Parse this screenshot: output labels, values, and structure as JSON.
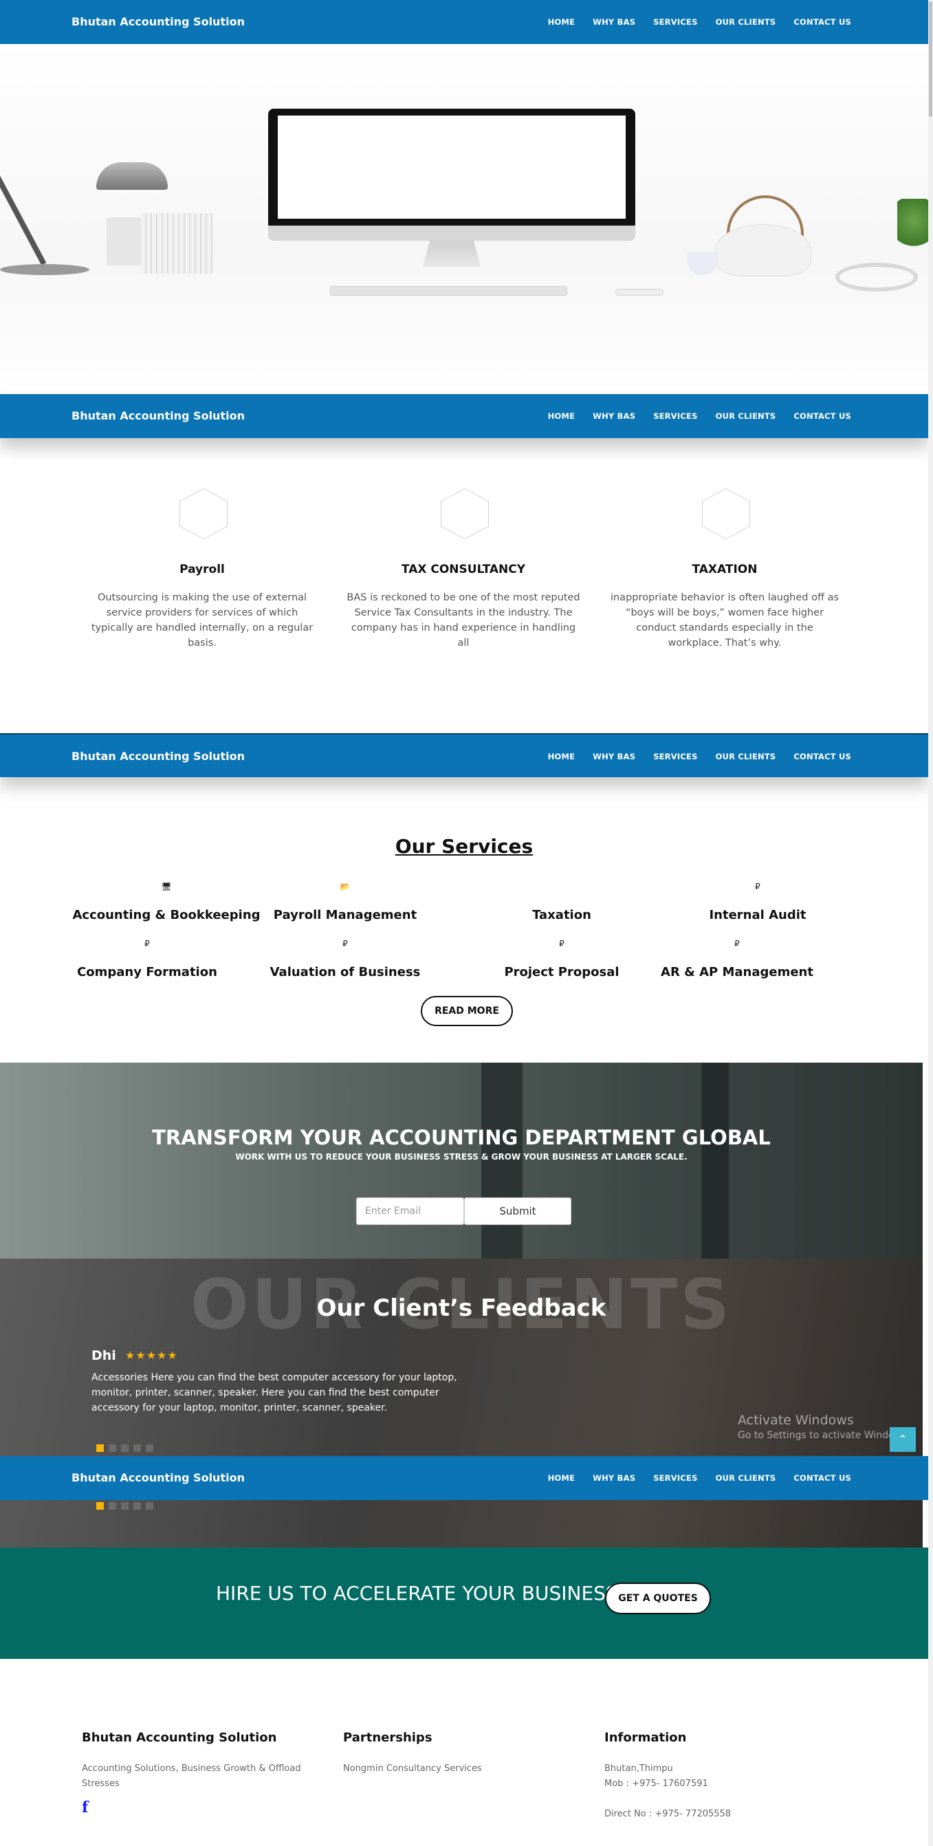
{
  "nav": {
    "brand": "Bhutan Accounting Solution",
    "items": [
      "HOME",
      "WHY BAS",
      "SERVICES",
      "OUR CLIENTS",
      "CONTACT US"
    ]
  },
  "hero": {
    "apple_glyph": ""
  },
  "cards": [
    {
      "icon": "",
      "title": "Payroll",
      "text": "Outsourcing is making the use of external service providers for services of which typically are handled internally, on a regular basis."
    },
    {
      "icon": "",
      "title": "TAX CONSULTANCY",
      "text": "BAS is reckoned to be one of the most reputed Service Tax Consultants in the industry. The company has in hand experience in handling all"
    },
    {
      "icon": "",
      "title": "TAXATION",
      "text": "inappropriate behavior is often laughed off as “boys will be boys,” women face higher conduct standards especially in the workplace. That’s why."
    }
  ],
  "services": {
    "title": "Our Services",
    "items": [
      {
        "icon": "🖥",
        "label": "Accounting & Bookkeeping"
      },
      {
        "icon": "📂",
        "label": "Payroll Management"
      },
      {
        "icon": "",
        "label": "Taxation"
      },
      {
        "icon": "₽",
        "label": "Internal Audit"
      },
      {
        "icon": "₽",
        "label": "Company Formation"
      },
      {
        "icon": "₽",
        "label": "Valuation of Business"
      },
      {
        "icon": "₽",
        "label": "Project Proposal"
      },
      {
        "icon": "₽",
        "label": "AR & AP Management"
      }
    ],
    "read_more": "READ MORE"
  },
  "transform": {
    "title": "TRANSFORM YOUR ACCOUNTING DEPARTMENT GLOBAL",
    "subtitle": "WORK WITH US TO REDUCE YOUR BUSINESS STRESS & GROW YOUR BUSINESS AT LARGER SCALE.",
    "email_placeholder": "Enter Email",
    "submit": "Submit"
  },
  "feedback": {
    "watermark": "OUR CLIENTS",
    "title": "Our Client’s Feedback",
    "name": "Dhi",
    "stars": "★★★★★",
    "rating": 5,
    "text": "Accessories Here you can find the best computer accessory for your laptop, monitor, printer, scanner, speaker. Here you can find the best computer accessory for your laptop, monitor, printer, scanner, speaker.",
    "slides": 5,
    "active_slide": 1
  },
  "windows": {
    "line1": "Activate Windows",
    "line2": "Go to Settings to activate Windows."
  },
  "scroll_top": "⌃",
  "hire": {
    "text": "HIRE US TO ACCELERATE YOUR BUSINESS",
    "button": "GET A QUOTES"
  },
  "footer": {
    "col1": {
      "title": "Bhutan Accounting Solution",
      "lines": [
        "Accounting Solutions, Business Growth & Offload",
        "Stresses"
      ],
      "facebook": "f"
    },
    "col2": {
      "title": "Partnerships",
      "lines": [
        "Nongmin Consultancy Services"
      ]
    },
    "col3": {
      "title": "Information",
      "lines": [
        "Bhutan,Thimpu",
        "Mob : +975- 17607591",
        "",
        "Direct No : +975- 77205558"
      ]
    }
  },
  "colors": {
    "nav_blue": "#0b74b5",
    "hire_teal": "#036b63",
    "star_gold": "#f5b50a",
    "scroll_top": "#3fb6cf"
  }
}
